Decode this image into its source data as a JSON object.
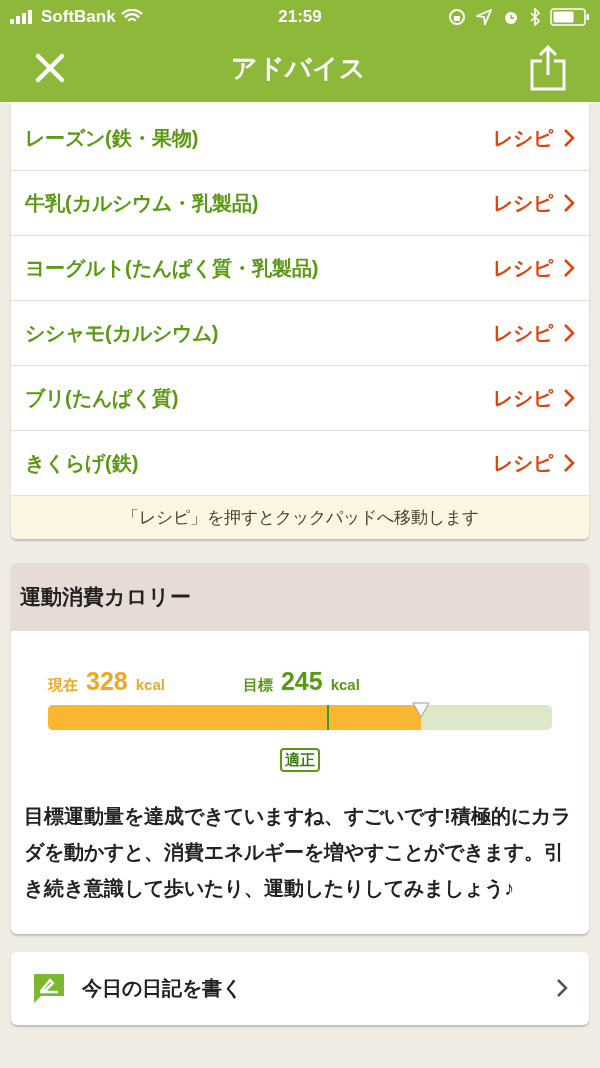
{
  "status_bar": {
    "carrier": "SoftBank",
    "time": "21:59"
  },
  "nav": {
    "title": "アドバイス"
  },
  "foods": [
    {
      "name": "レーズン(鉄・果物)",
      "link": "レシピ"
    },
    {
      "name": "牛乳(カルシウム・乳製品)",
      "link": "レシピ"
    },
    {
      "name": "ヨーグルト(たんぱく質・乳製品)",
      "link": "レシピ"
    },
    {
      "name": "シシャモ(カルシウム)",
      "link": "レシピ"
    },
    {
      "name": "ブリ(たんぱく質)",
      "link": "レシピ"
    },
    {
      "name": "きくらげ(鉄)",
      "link": "レシピ"
    }
  ],
  "note": "「レシピ」を押すとクックパッドへ移動します",
  "exercise": {
    "title": "運動消費カロリー",
    "current_label": "現在",
    "current_value": "328",
    "current_unit": "kcal",
    "target_label": "目標",
    "target_value": "245",
    "target_unit": "kcal",
    "level": 0.74,
    "status": "適正",
    "message": "目標運動量を達成できていますね、すごいです!積極的にカラダを動かすと、消費エネルギーを増やすことができます。引き続き意識して歩いたり、運動したりしてみましょう♪"
  },
  "diary": {
    "label": "今日の日記を書く"
  }
}
